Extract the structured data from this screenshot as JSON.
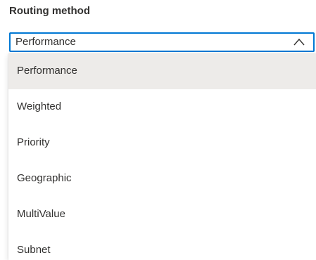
{
  "routing": {
    "label": "Routing method",
    "selected_value": "Performance",
    "chevron_icon": "chevron-up-icon",
    "accent_color": "#0078d4",
    "options": [
      {
        "label": "Performance",
        "selected": true
      },
      {
        "label": "Weighted",
        "selected": false
      },
      {
        "label": "Priority",
        "selected": false
      },
      {
        "label": "Geographic",
        "selected": false
      },
      {
        "label": "MultiValue",
        "selected": false
      },
      {
        "label": "Subnet",
        "selected": false
      }
    ]
  }
}
